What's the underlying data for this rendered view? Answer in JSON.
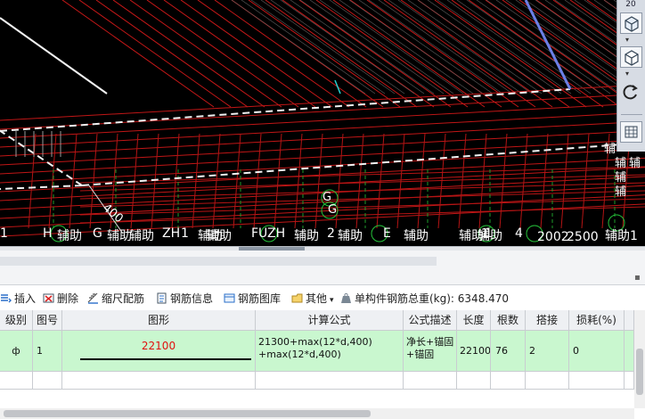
{
  "cad": {
    "zoom_label": "20",
    "axis_labels": [
      "1",
      "H",
      "辅助",
      "G",
      "辅助",
      "辅助",
      "ZH",
      "辅助",
      "1",
      "辅助",
      "FUZH",
      "辅助",
      "2",
      "辅助",
      "E",
      "辅助",
      "辅助",
      "1",
      "辅助",
      "4",
      "2002",
      "2500",
      "辅助1"
    ],
    "ring_labels": [
      "G",
      "G",
      "1"
    ],
    "dimension_text": "400",
    "right_labels": [
      "辅",
      "辅",
      "辅",
      "辅",
      "辅"
    ]
  },
  "right_toolbar": {
    "icons": [
      "view-cube-icon",
      "cube-icon",
      "rotate-icon",
      "grid-icon"
    ]
  },
  "toolbar": {
    "insert": "插入",
    "delete": "删除",
    "scale_rebar": "缩尺配筋",
    "rebar_info": "钢筋信息",
    "rebar_library": "钢筋图库",
    "other": "其他",
    "total_weight": "单构件钢筋总重(kg): 6348.470"
  },
  "table": {
    "headers": [
      "级别",
      "图号",
      "图形",
      "计算公式",
      "公式描述",
      "长度",
      "根数",
      "搭接",
      "损耗(%)"
    ],
    "rows": [
      {
        "grade_symbol": "ф",
        "figure_no": "1",
        "shape_value": "22100",
        "formula_line1": "21300+max(12*d,400)",
        "formula_line2": "+max(12*d,400)",
        "desc_line1": "净长+锚固",
        "desc_line2": "+锚固",
        "length": "22100",
        "count": "76",
        "lap": "2",
        "loss": "0"
      }
    ]
  }
}
